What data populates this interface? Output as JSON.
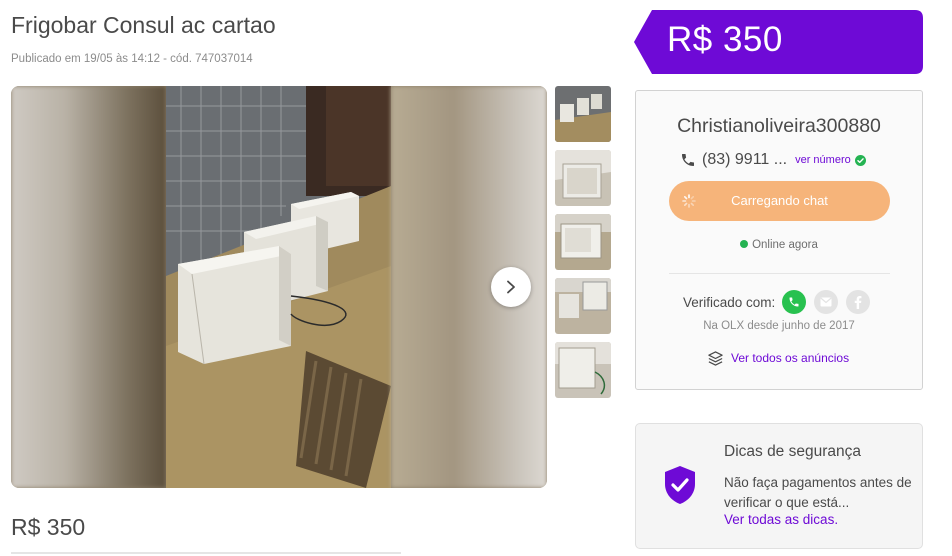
{
  "listing": {
    "title": "Frigobar Consul ac cartao",
    "meta": "Publicado em 19/05 às 14:12 - cód. 747037014",
    "price_bottom": "R$ 350"
  },
  "gallery": {
    "next_icon": "chevron-right-icon",
    "thumbnail_count": 5
  },
  "price_banner": {
    "price": "R$ 350",
    "color": "#6e0ad6"
  },
  "seller": {
    "name": "Christianoliveira300880",
    "phone": "(83) 9911 ...",
    "see_number_label": "ver número",
    "chat_button_label": "Carregando chat",
    "online_status": "Online agora",
    "verified_label": "Verificado com:",
    "verified_icons": [
      "phone-icon",
      "email-icon",
      "facebook-icon"
    ],
    "member_since": "Na OLX desde junho de 2017",
    "all_ads_label": "Ver todos os anúncios"
  },
  "safety": {
    "title": "Dicas de segurança",
    "text": "Não faça pagamentos antes de verificar o que está...",
    "link": "Ver todas as dicas."
  },
  "colors": {
    "accent": "#6e0ad6",
    "chat_button": "#f6b47a",
    "online_dot": "#24b352",
    "whatsapp_green": "#28c14f"
  }
}
